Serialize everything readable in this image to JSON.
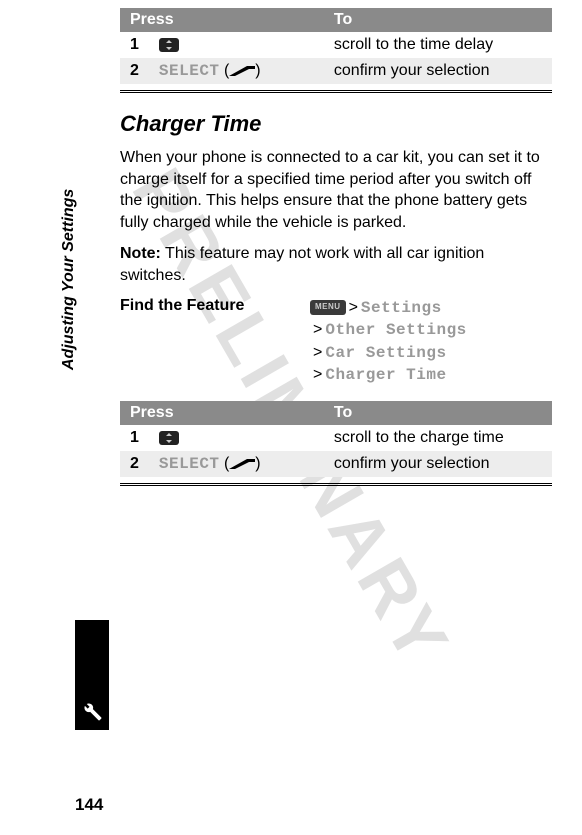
{
  "watermark": "PRELIMINARY",
  "sidebar_title": "Adjusting Your Settings",
  "page_number": "144",
  "table1": {
    "header_press": "Press",
    "header_to": "To",
    "row1": {
      "step": "1",
      "to": "scroll to the time delay"
    },
    "row2": {
      "step": "2",
      "key": "SELECT",
      "to": "confirm your selection"
    }
  },
  "section_title": "Charger Time",
  "paragraph1": "When your phone is connected to a car kit, you can set it to charge itself for a specified time period after you switch off the ignition. This helps ensure that the phone battery gets fully charged while the vehicle is parked.",
  "note_label": "Note:",
  "note_text": " This feature may not work with all car ignition switches.",
  "find_feature_label": "Find the Feature",
  "menu_key_label": "MENU",
  "menu_path": {
    "item1": "Settings",
    "item2": "Other Settings",
    "item3": "Car Settings",
    "item4": "Charger Time"
  },
  "table2": {
    "header_press": "Press",
    "header_to": "To",
    "row1": {
      "step": "1",
      "to": "scroll to the charge time"
    },
    "row2": {
      "step": "2",
      "key": "SELECT",
      "to": "confirm your selection"
    }
  }
}
